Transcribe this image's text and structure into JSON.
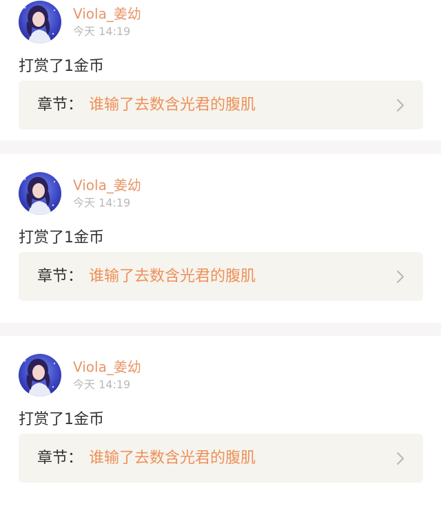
{
  "feed": {
    "items": [
      {
        "username": "Viola_姜幼",
        "timestamp": "今天 14:19",
        "reward": "打赏了1金币",
        "chapter_prefix": "章节：",
        "chapter_title": "谁输了去数含光君的腹肌"
      },
      {
        "username": "Viola_姜幼",
        "timestamp": "今天 14:19",
        "reward": "打赏了1金币",
        "chapter_prefix": "章节：",
        "chapter_title": "谁输了去数含光君的腹肌"
      },
      {
        "username": "Viola_姜幼",
        "timestamp": "今天 14:19",
        "reward": "打赏了1金币",
        "chapter_prefix": "章节：",
        "chapter_title": "谁输了去数含光君的腹肌"
      }
    ]
  },
  "icons": {
    "avatar": "user-avatar",
    "chevron": "chevron-right-icon"
  },
  "colors": {
    "username": "#e89567",
    "chapter_title": "#ef8f58",
    "card_background": "#f5f4ee",
    "divider": "#f7f5f5"
  }
}
